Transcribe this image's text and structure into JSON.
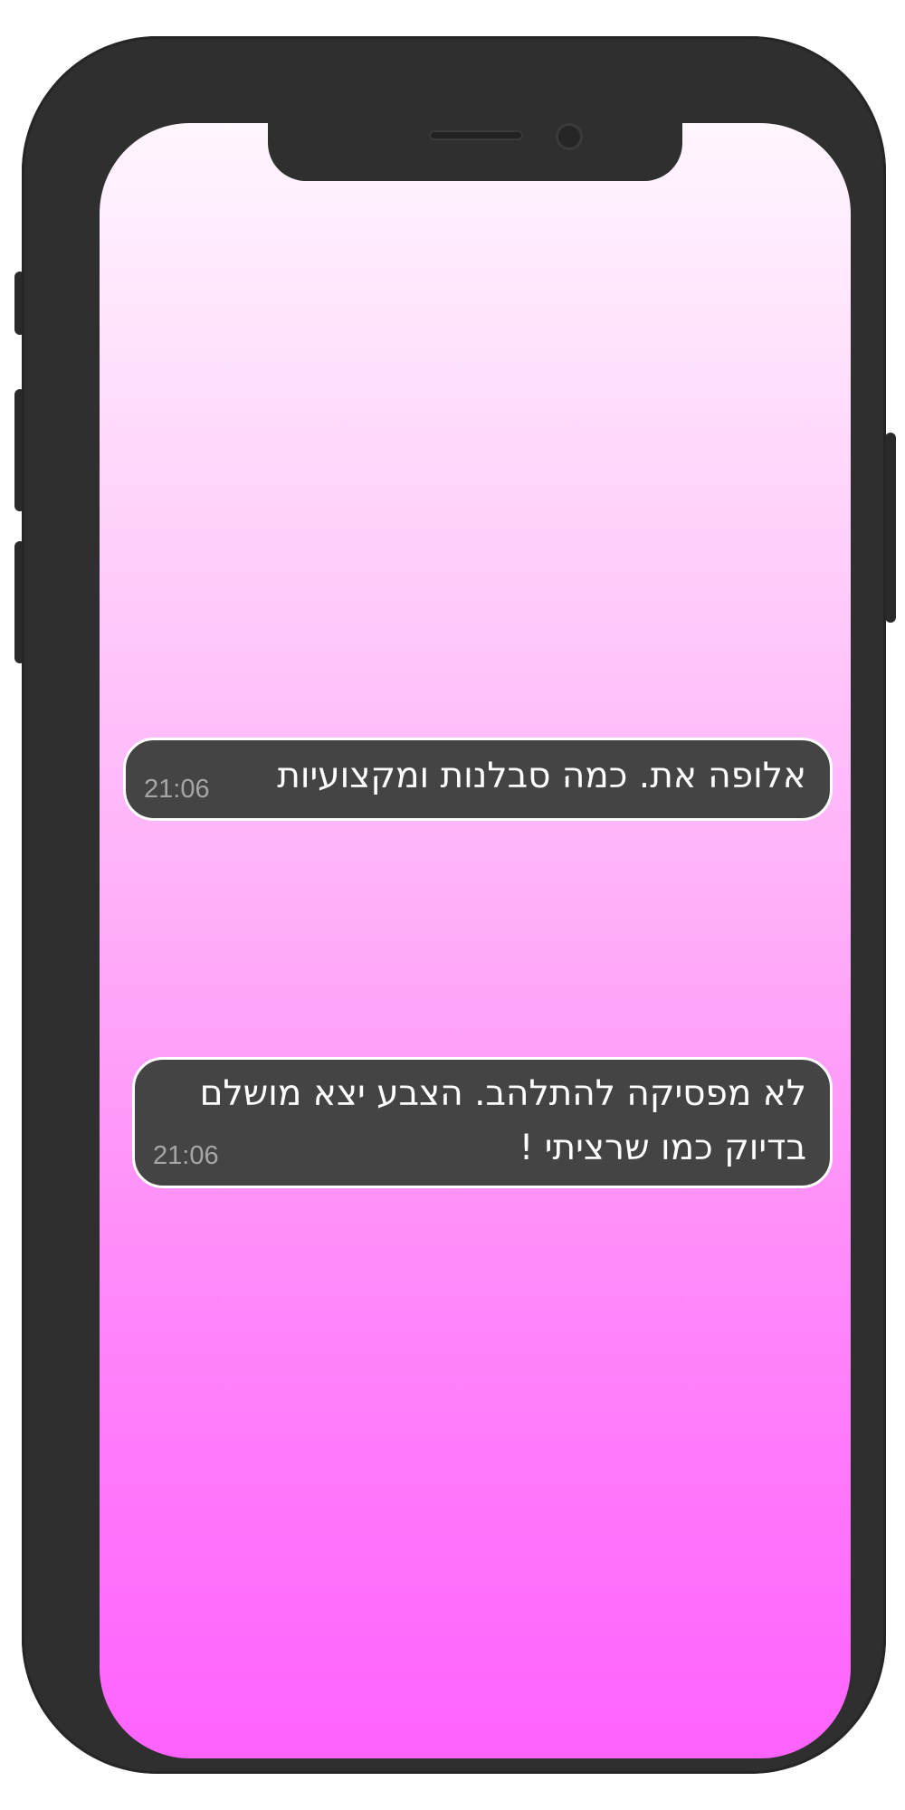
{
  "conversation": {
    "messages": [
      {
        "lines": [
          "אלופה את. כמה סבלנות ומקצועיות"
        ],
        "time": "21:06"
      },
      {
        "lines": [
          "לא מפסיקה להתלהב. הצבע יצא מושלם",
          "בדיוק כמו שרציתי !"
        ],
        "time": "21:06"
      }
    ]
  },
  "colors": {
    "phone_frame": "#2f2f2f",
    "bubble_background": "#454445",
    "bubble_border": "#ffffff",
    "screen_gradient_top": "#fff6fe",
    "screen_gradient_bottom": "#fe63fd",
    "timestamp": "#a6a6a6"
  }
}
